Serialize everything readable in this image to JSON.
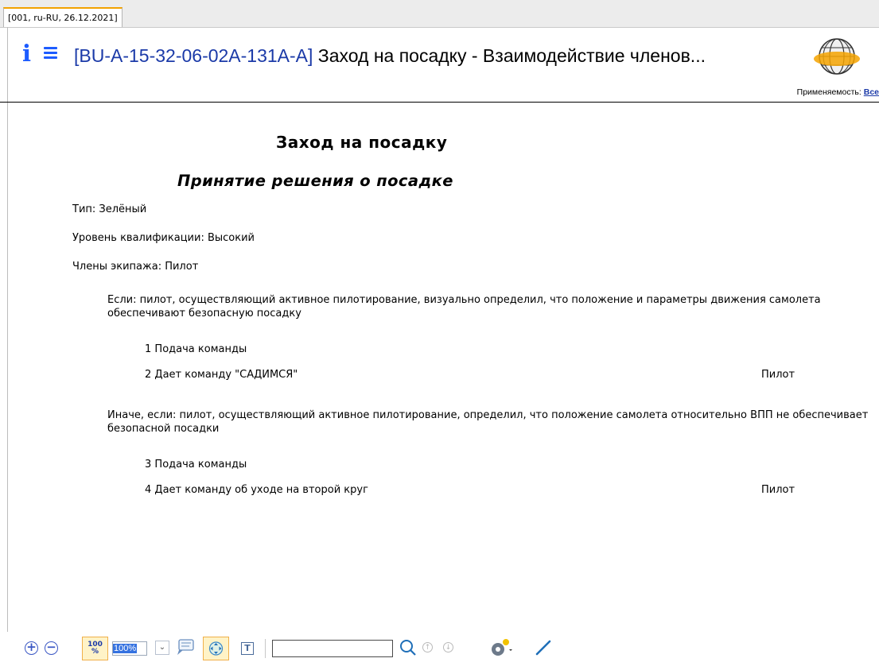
{
  "tab": {
    "label": "[001, ru-RU, 26.12.2021]"
  },
  "header": {
    "code": "[BU-A-15-32-06-02A-131A-A]",
    "title": " Заход на посадку - Взаимодействие членов...",
    "applicability_label": "Применяемость:",
    "applicability_link": "Все"
  },
  "document": {
    "title": "Заход на посадку",
    "subtitle": "Принятие решения о посадке",
    "type": "Тип: Зелёный",
    "level": "Уровень квалификации: Высокий",
    "crew": "Члены экипажа: Пилот",
    "blocks": [
      {
        "condition": "Если: пилот, осуществляющий активное пилотирование, визуально определил, что положение и параметры движения самолета обеспечивают безопасную посадку",
        "steps": [
          {
            "number": "1",
            "text": "Подача команды",
            "role": ""
          },
          {
            "number": "2",
            "text": "Дает команду \"САДИМСЯ\"",
            "role": "Пилот"
          }
        ]
      },
      {
        "condition": "Иначе, если: пилот, осуществляющий активное пилотирование, определил, что положение самолета относительно ВПП не обеспечивает безопасной посадки",
        "steps": [
          {
            "number": "3",
            "text": "Подача команды",
            "role": ""
          },
          {
            "number": "4",
            "text": "Дает команду об уходе на второй круг",
            "role": "Пилот"
          }
        ]
      }
    ]
  },
  "toolbar": {
    "zoom_value": "100%",
    "zoom_fit_label": "100\n%",
    "search_value": "",
    "icons": [
      "zoom-in-icon",
      "zoom-out-icon",
      "zoom-100-icon",
      "zoom-select-icon",
      "comments-icon",
      "pan-icon",
      "text-select-icon",
      "search-icon",
      "prev-icon",
      "next-icon",
      "settings-icon",
      "pen-icon"
    ]
  },
  "colors": {
    "accent": "#1d5cff",
    "link": "#1b3aa8",
    "highlight": "#fff3c7",
    "tab_accent": "#f2a200"
  }
}
